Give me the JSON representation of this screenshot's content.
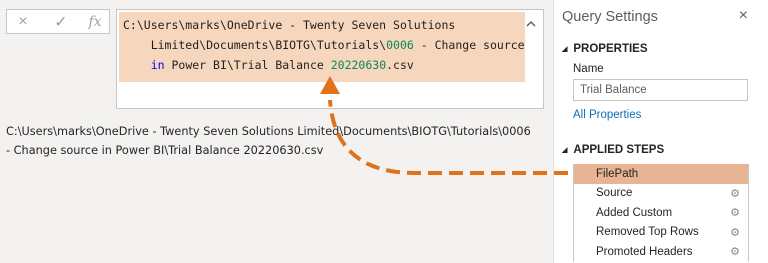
{
  "formula_bar": {
    "cancel_icon": "×",
    "commit_icon": "✓",
    "fx_label": "fx",
    "collapse_icon": "chevron-up",
    "line1": "C:\\Users\\marks\\OneDrive - Twenty Seven Solutions",
    "line2_a": "    Limited\\Documents\\BIOTG\\Tutorials\\",
    "line2_num": "0006",
    "line2_b": " - Change source",
    "line3_kw": "in",
    "line3_a": " Power BI\\Trial Balance ",
    "line3_num": "20220630",
    "line3_b": ".csv"
  },
  "result": {
    "text": "C:\\Users\\marks\\OneDrive - Twenty Seven Solutions Limited\\Documents\\BIOTG\\Tutorials\\0006 - Change source in Power BI\\Trial Balance 20220630.csv"
  },
  "query_settings": {
    "title": "Query Settings",
    "close_icon": "×",
    "properties_heading": "PROPERTIES",
    "name_label": "Name",
    "name_value": "Trial Balance",
    "all_properties_link": "All Properties",
    "applied_steps_heading": "APPLIED STEPS",
    "steps": [
      {
        "label": "FilePath",
        "selected": true
      },
      {
        "label": "Source"
      },
      {
        "label": "Added Custom"
      },
      {
        "label": "Removed Top Rows"
      },
      {
        "label": "Promoted Headers"
      }
    ]
  },
  "colors": {
    "highlight": "#f6d7bd",
    "selected_step": "#e7b594",
    "arrow": "#e0721a"
  }
}
